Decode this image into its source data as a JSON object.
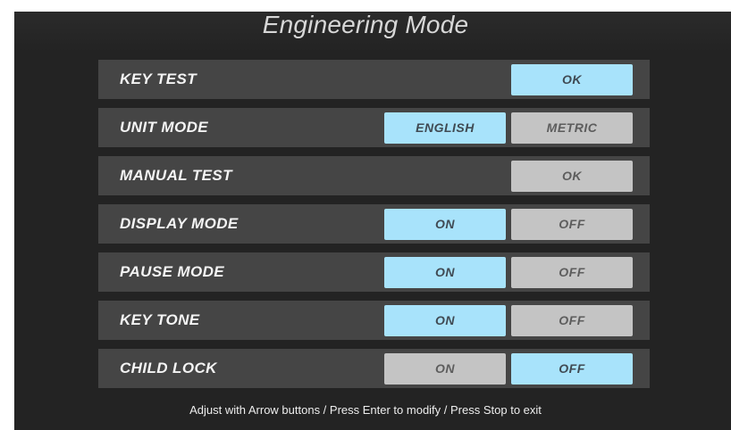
{
  "title": "Engineering Mode",
  "rows": [
    {
      "label": "KEY TEST",
      "buttons": [
        "OK"
      ]
    },
    {
      "label": "UNIT MODE",
      "buttons": [
        "ENGLISH",
        "METRIC"
      ],
      "selected": "ENGLISH"
    },
    {
      "label": "MANUAL TEST",
      "buttons": [
        "OK"
      ]
    },
    {
      "label": "DISPLAY MODE",
      "buttons": [
        "ON",
        "OFF"
      ],
      "selected": "ON"
    },
    {
      "label": "PAUSE MODE",
      "buttons": [
        "ON",
        "OFF"
      ],
      "selected": "ON"
    },
    {
      "label": "KEY TONE",
      "buttons": [
        "ON",
        "OFF"
      ],
      "selected": "ON"
    },
    {
      "label": "CHILD LOCK",
      "buttons": [
        "ON",
        "OFF"
      ],
      "selected": "OFF"
    }
  ],
  "footer": "Adjust with Arrow buttons  /  Press Enter to modify  /  Press Stop to exit",
  "colors": {
    "background": "#232323",
    "row": "#454545",
    "selected": "#a8e3fb",
    "unselected": "#c4c4c4",
    "text": "#f4f4f4"
  }
}
